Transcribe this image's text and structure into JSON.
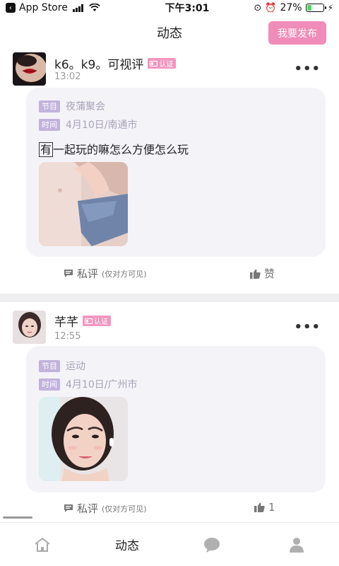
{
  "status_bar": {
    "back_app": "App Store",
    "time": "下午3:01",
    "battery": "27%",
    "battery_level": 0.27
  },
  "nav": {
    "title": "动态",
    "publish_label": "我要发布"
  },
  "posts": [
    {
      "username": "k6。k9。可视评",
      "badge": "认证",
      "time": "13:02",
      "more": "•••",
      "program_tag": "节目",
      "program": "夜蒲聚会",
      "time_tag": "时间",
      "date_location": "4月10日/南通市",
      "text_first": "有",
      "text_rest": "一起玩的嘛怎么方便怎么玩",
      "comment_label": "私评",
      "comment_hint": "(仅对方可见)",
      "like_label": "赞"
    },
    {
      "username": "芊芊",
      "badge": "认证",
      "time": "12:55",
      "more": "•••",
      "program_tag": "节目",
      "program": "运动",
      "time_tag": "时间",
      "date_location": "4月10日/广州市",
      "comment_label": "私评",
      "comment_hint": "(仅对方可见)",
      "like_label": "1"
    }
  ],
  "tabbar": {
    "items": [
      {
        "icon": "home-icon",
        "label": ""
      },
      {
        "icon": "",
        "label": "动态"
      },
      {
        "icon": "message-icon",
        "label": ""
      },
      {
        "icon": "profile-icon",
        "label": ""
      }
    ]
  },
  "colors": {
    "accent_pink": "#f08cb8",
    "tag_purple": "#c1b3db",
    "card_bg": "#f4f3f8"
  }
}
